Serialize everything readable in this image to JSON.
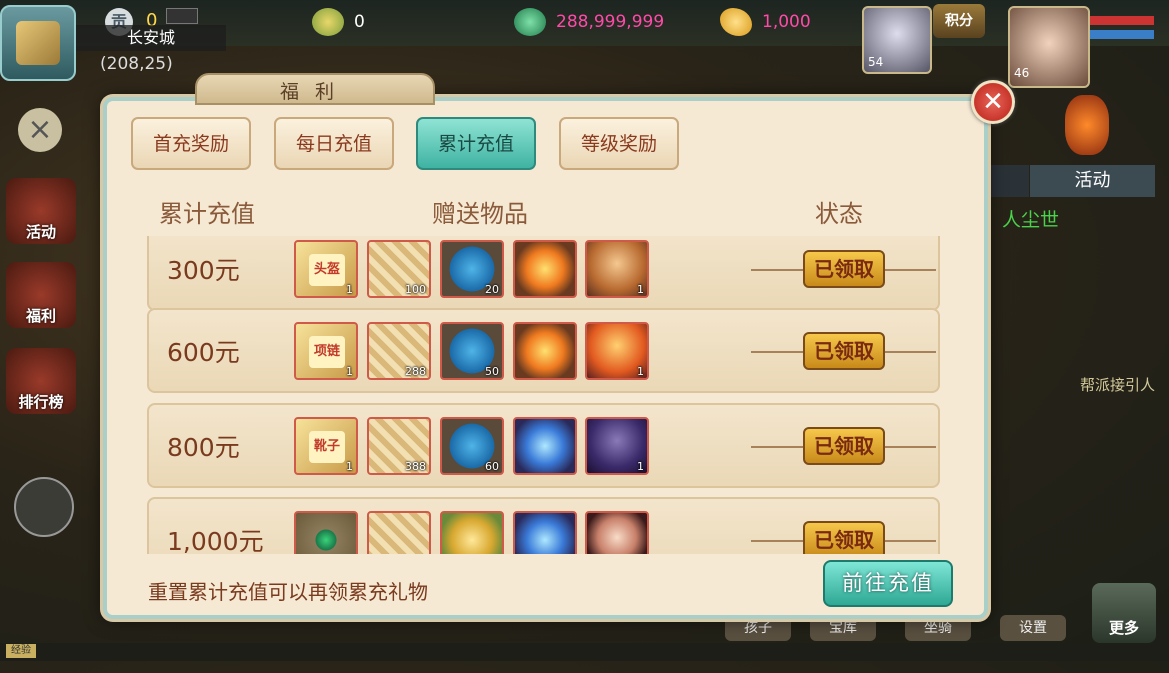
{
  "hud": {
    "gong_icon": "贡",
    "gong_value": "0",
    "city": "长安城",
    "coords": "(208,25)",
    "res1_value": "0",
    "res2_value": "288,999,999",
    "res3_value": "1,000",
    "pet_level": "54",
    "score_label": "积分",
    "hero_level": "46",
    "side_buttons": [
      "活动",
      "福利",
      "排行榜"
    ],
    "right_tab": "活动",
    "npc_name": "人尘世",
    "npc_guide": "帮派接引人",
    "more_label": "更多",
    "dock_buttons": [
      "孩子",
      "宝库",
      "坐骑",
      "设置"
    ],
    "bottom_tag": "经验"
  },
  "modal": {
    "title": "福利",
    "close_label": "✕",
    "tabs": [
      {
        "label": "首充奖励",
        "active": false
      },
      {
        "label": "每日充值",
        "active": false
      },
      {
        "label": "累计充值",
        "active": true
      },
      {
        "label": "等级奖励",
        "active": false
      }
    ],
    "columns": [
      "累计充值",
      "赠送物品",
      "状态"
    ],
    "rows": [
      {
        "amount": "300元",
        "status": "已领取",
        "items": [
          {
            "kind": "it-scroll",
            "tag": "头盔",
            "count": "1"
          },
          {
            "kind": "it-map",
            "count": "100"
          },
          {
            "kind": "it-egg",
            "count": "20"
          },
          {
            "kind": "it-fire",
            "count": ""
          },
          {
            "kind": "it-pet1",
            "count": "1"
          }
        ]
      },
      {
        "amount": "600元",
        "status": "已领取",
        "items": [
          {
            "kind": "it-scroll",
            "tag": "项链",
            "count": "1"
          },
          {
            "kind": "it-map",
            "count": "288"
          },
          {
            "kind": "it-egg",
            "count": "50"
          },
          {
            "kind": "it-fire",
            "count": ""
          },
          {
            "kind": "it-pet2",
            "count": "1"
          }
        ]
      },
      {
        "amount": "800元",
        "status": "已领取",
        "items": [
          {
            "kind": "it-scroll",
            "tag": "靴子",
            "count": "1"
          },
          {
            "kind": "it-map",
            "count": "388"
          },
          {
            "kind": "it-egg",
            "count": "60"
          },
          {
            "kind": "it-blue",
            "count": ""
          },
          {
            "kind": "it-pet3",
            "count": "1"
          }
        ]
      },
      {
        "amount": "1,000元",
        "status": "已领取",
        "items": [
          {
            "kind": "it-jade",
            "count": ""
          },
          {
            "kind": "it-map",
            "count": ""
          },
          {
            "kind": "it-gold",
            "count": ""
          },
          {
            "kind": "it-blue",
            "count": ""
          },
          {
            "kind": "it-girl",
            "count": ""
          }
        ]
      }
    ],
    "footer_note": "重置累计充值可以再领累充礼物",
    "go_button": "前往充值"
  }
}
